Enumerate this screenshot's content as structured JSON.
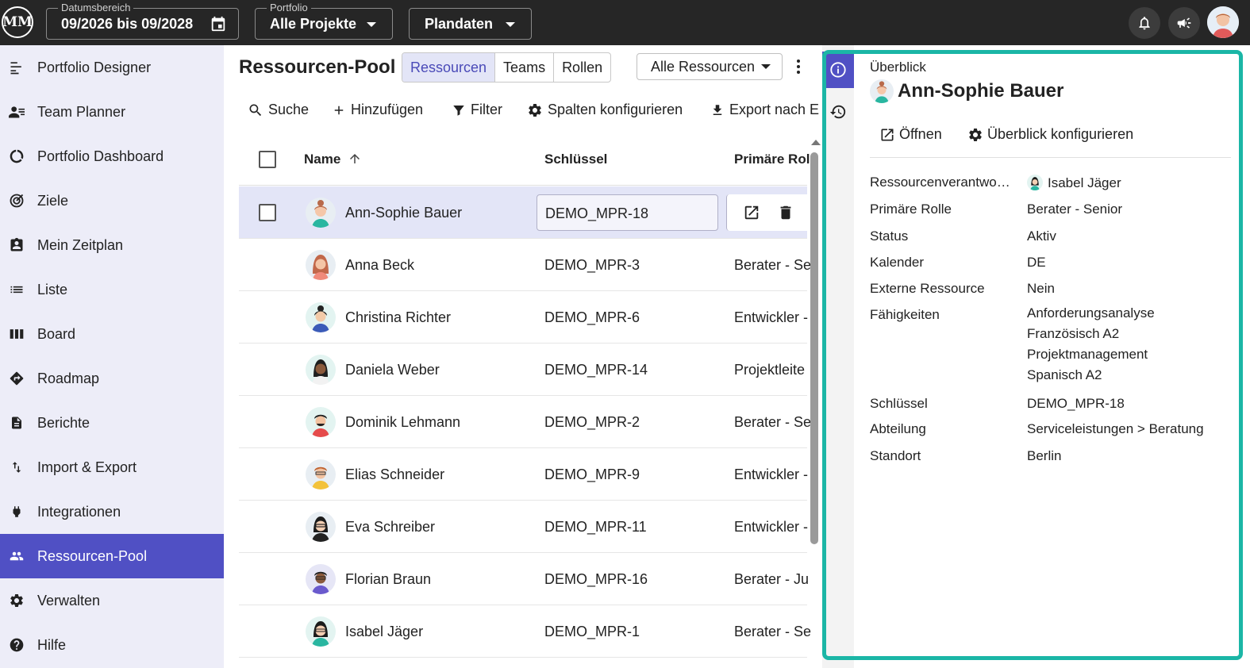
{
  "topbar": {
    "logo_text": "MM",
    "date_range": {
      "legend": "Datumsbereich",
      "value": "09/2026 bis 09/2028",
      "icon": "calendar-icon"
    },
    "portfolio": {
      "legend": "Portfolio",
      "value": "Alle Projekte"
    },
    "data_mode": {
      "value": "Plandaten"
    },
    "icons": [
      "bell-icon",
      "megaphone-icon",
      "user-avatar"
    ]
  },
  "sidebar": {
    "items": [
      {
        "label": "Portfolio Designer",
        "icon": "portfolio-designer-icon"
      },
      {
        "label": "Team Planner",
        "icon": "team-planner-icon"
      },
      {
        "label": "Portfolio Dashboard",
        "icon": "dashboard-icon"
      },
      {
        "label": "Ziele",
        "icon": "target-icon"
      },
      {
        "label": "Mein Zeitplan",
        "icon": "schedule-icon"
      },
      {
        "label": "Liste",
        "icon": "list-icon"
      },
      {
        "label": "Board",
        "icon": "board-icon"
      },
      {
        "label": "Roadmap",
        "icon": "roadmap-icon"
      },
      {
        "label": "Berichte",
        "icon": "report-icon"
      },
      {
        "label": "Import & Export",
        "icon": "import-export-icon"
      },
      {
        "label": "Integrationen",
        "icon": "plug-icon"
      },
      {
        "label": "Ressourcen-Pool",
        "icon": "people-icon",
        "active": true
      },
      {
        "label": "Verwalten",
        "icon": "gear-icon"
      },
      {
        "label": "Hilfe",
        "icon": "help-icon"
      }
    ],
    "active_color": "#5050c4"
  },
  "main": {
    "title": "Ressourcen-Pool",
    "tabs": [
      {
        "label": "Ressourcen",
        "active": true
      },
      {
        "label": "Teams"
      },
      {
        "label": "Rollen"
      }
    ],
    "filter": {
      "value": "Alle Ressourcen"
    },
    "toolbar": {
      "search": "Suche",
      "add": "Hinzufügen",
      "filter": "Filter",
      "columns": "Spalten konfigurieren",
      "export": "Export nach E"
    },
    "columns": {
      "name": "Name",
      "key": "Schlüssel",
      "role": "Primäre Rol"
    },
    "rows": [
      {
        "name": "Ann-Sophie Bauer",
        "key": "DEMO_MPR-18",
        "role": "",
        "selected": true
      },
      {
        "name": "Anna Beck",
        "key": "DEMO_MPR-3",
        "role": "Berater - Se"
      },
      {
        "name": "Christina Richter",
        "key": "DEMO_MPR-6",
        "role": "Entwickler -"
      },
      {
        "name": "Daniela Weber",
        "key": "DEMO_MPR-14",
        "role": "Projektleite"
      },
      {
        "name": "Dominik Lehmann",
        "key": "DEMO_MPR-2",
        "role": "Berater - Se"
      },
      {
        "name": "Elias Schneider",
        "key": "DEMO_MPR-9",
        "role": "Entwickler -"
      },
      {
        "name": "Eva Schreiber",
        "key": "DEMO_MPR-11",
        "role": "Entwickler -"
      },
      {
        "name": "Florian Braun",
        "key": "DEMO_MPR-16",
        "role": "Berater - Ju"
      },
      {
        "name": "Isabel Jäger",
        "key": "DEMO_MPR-1",
        "role": "Berater - Se"
      }
    ]
  },
  "panel": {
    "overview": "Überblick",
    "name": "Ann-Sophie Bauer",
    "actions": {
      "open": "Öffnen",
      "configure": "Überblick konfigurieren"
    },
    "fields": {
      "owner": {
        "label": "Ressourcenverantwo…",
        "value": "Isabel Jäger"
      },
      "role": {
        "label": "Primäre Rolle",
        "value": "Berater - Senior"
      },
      "status": {
        "label": "Status",
        "value": "Aktiv"
      },
      "calendar": {
        "label": "Kalender",
        "value": "DE"
      },
      "external": {
        "label": "Externe Ressource",
        "value": "Nein"
      },
      "skills": {
        "label": "Fähigkeiten",
        "values": [
          "Anforderungsanalyse",
          "Französisch A2",
          "Projektmanagement",
          "Spanisch A2"
        ]
      },
      "key": {
        "label": "Schlüssel",
        "value": "DEMO_MPR-18"
      },
      "department": {
        "label": "Abteilung",
        "value": "Serviceleistungen > Beratung"
      },
      "location": {
        "label": "Standort",
        "value": "Berlin"
      }
    },
    "highlight_color": "#1bb6a6"
  }
}
